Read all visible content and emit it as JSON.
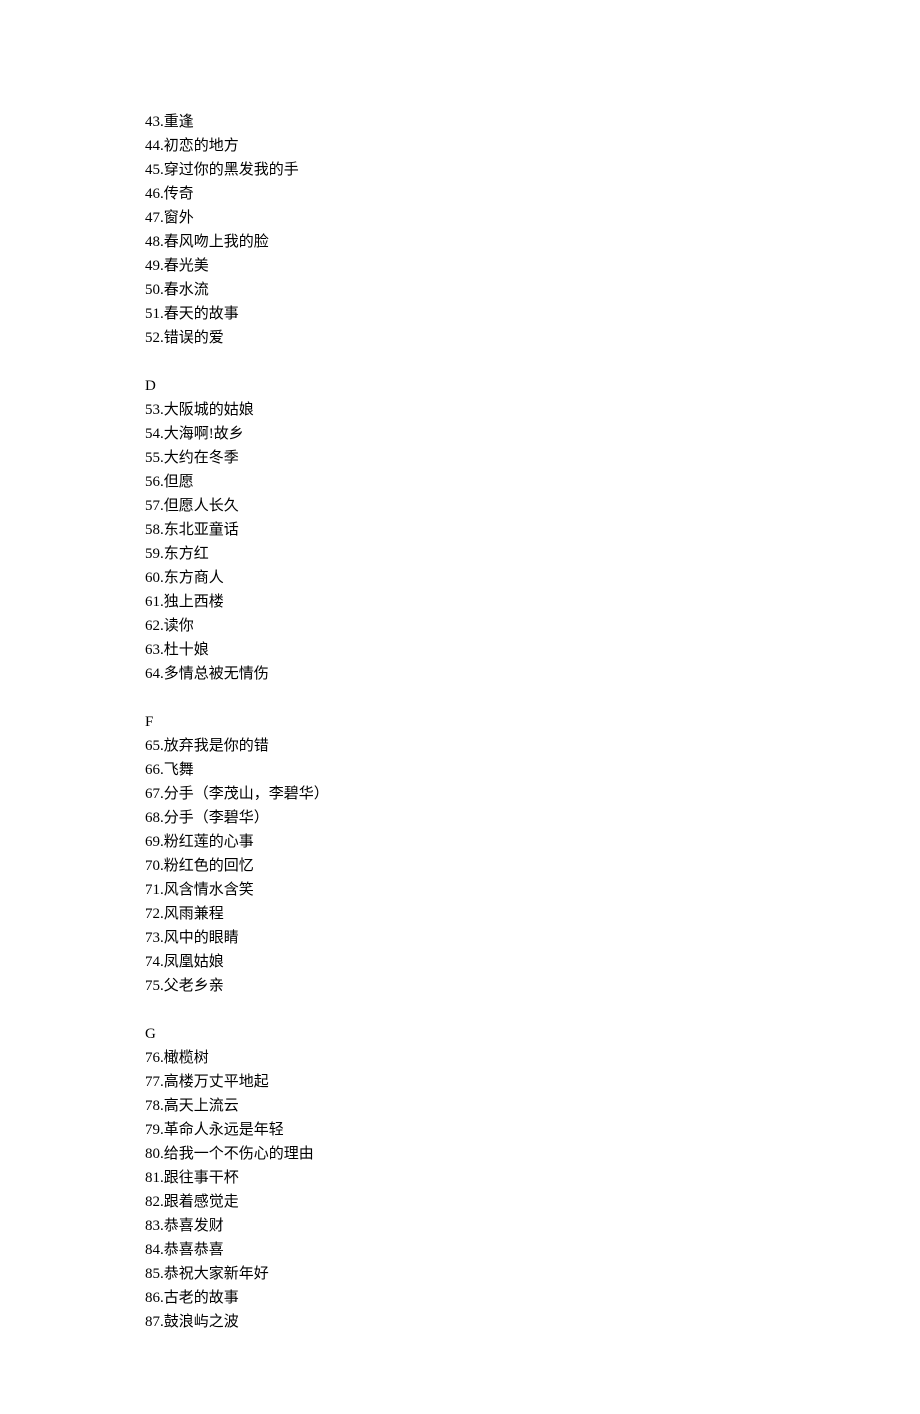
{
  "sections": [
    {
      "header": null,
      "items": [
        {
          "num": "43",
          "title": "重逢"
        },
        {
          "num": "44",
          "title": "初恋的地方"
        },
        {
          "num": "45",
          "title": "穿过你的黑发我的手"
        },
        {
          "num": "46",
          "title": "传奇"
        },
        {
          "num": "47",
          "title": "窗外"
        },
        {
          "num": "48",
          "title": "春风吻上我的脸"
        },
        {
          "num": "49",
          "title": "春光美"
        },
        {
          "num": "50",
          "title": "春水流"
        },
        {
          "num": "51",
          "title": "春天的故事"
        },
        {
          "num": "52",
          "title": "错误的爱"
        }
      ]
    },
    {
      "header": "D",
      "items": [
        {
          "num": "53",
          "title": "大阪城的姑娘"
        },
        {
          "num": "54",
          "title": "大海啊!故乡"
        },
        {
          "num": "55",
          "title": "大约在冬季"
        },
        {
          "num": "56",
          "title": "但愿"
        },
        {
          "num": "57",
          "title": "但愿人长久"
        },
        {
          "num": "58",
          "title": "东北亚童话"
        },
        {
          "num": "59",
          "title": "东方红"
        },
        {
          "num": "60",
          "title": "东方商人"
        },
        {
          "num": "61",
          "title": "独上西楼"
        },
        {
          "num": "62",
          "title": "读你"
        },
        {
          "num": "63",
          "title": "杜十娘"
        },
        {
          "num": "64",
          "title": "多情总被无情伤"
        }
      ]
    },
    {
      "header": "F",
      "items": [
        {
          "num": "65",
          "title": "放弃我是你的错"
        },
        {
          "num": "66",
          "title": "飞舞"
        },
        {
          "num": "67",
          "title": "分手（李茂山，李碧华）"
        },
        {
          "num": "68",
          "title": "分手（李碧华）"
        },
        {
          "num": "69",
          "title": "粉红莲的心事"
        },
        {
          "num": "70",
          "title": "粉红色的回忆"
        },
        {
          "num": "71",
          "title": "风含情水含笑"
        },
        {
          "num": "72",
          "title": "风雨兼程"
        },
        {
          "num": "73",
          "title": "风中的眼睛"
        },
        {
          "num": "74",
          "title": "凤凰姑娘"
        },
        {
          "num": "75",
          "title": "父老乡亲"
        }
      ]
    },
    {
      "header": "G",
      "items": [
        {
          "num": "76",
          "title": "橄榄树"
        },
        {
          "num": "77",
          "title": "高楼万丈平地起"
        },
        {
          "num": "78",
          "title": "高天上流云"
        },
        {
          "num": "79",
          "title": "革命人永远是年轻"
        },
        {
          "num": "80",
          "title": "给我一个不伤心的理由"
        },
        {
          "num": "81",
          "title": "跟往事干杯"
        },
        {
          "num": "82",
          "title": "跟着感觉走"
        },
        {
          "num": "83",
          "title": "恭喜发财"
        },
        {
          "num": "84",
          "title": "恭喜恭喜"
        },
        {
          "num": "85",
          "title": "恭祝大家新年好"
        },
        {
          "num": "86",
          "title": "古老的故事"
        },
        {
          "num": "87",
          "title": "鼓浪屿之波"
        }
      ]
    }
  ]
}
